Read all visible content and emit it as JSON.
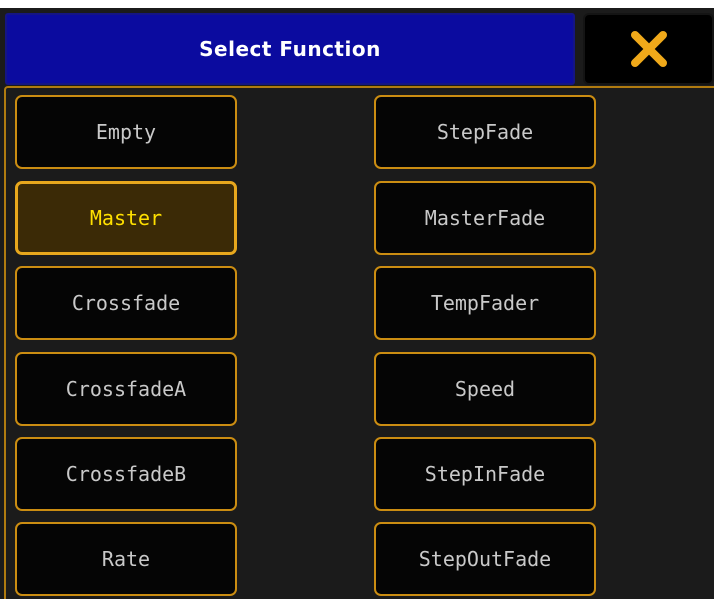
{
  "dialog": {
    "title": "Select Function",
    "close_icon": "close-x-icon",
    "accent_color": "#cb8d12",
    "title_bar_color": "#0b0b9f",
    "selected_text_color": "#ffe000"
  },
  "functions": {
    "left": [
      "Empty",
      "Master",
      "Crossfade",
      "CrossfadeA",
      "CrossfadeB",
      "Rate"
    ],
    "right": [
      "StepFade",
      "MasterFade",
      "TempFader",
      "Speed",
      "StepInFade",
      "StepOutFade"
    ],
    "selected": "Master"
  }
}
